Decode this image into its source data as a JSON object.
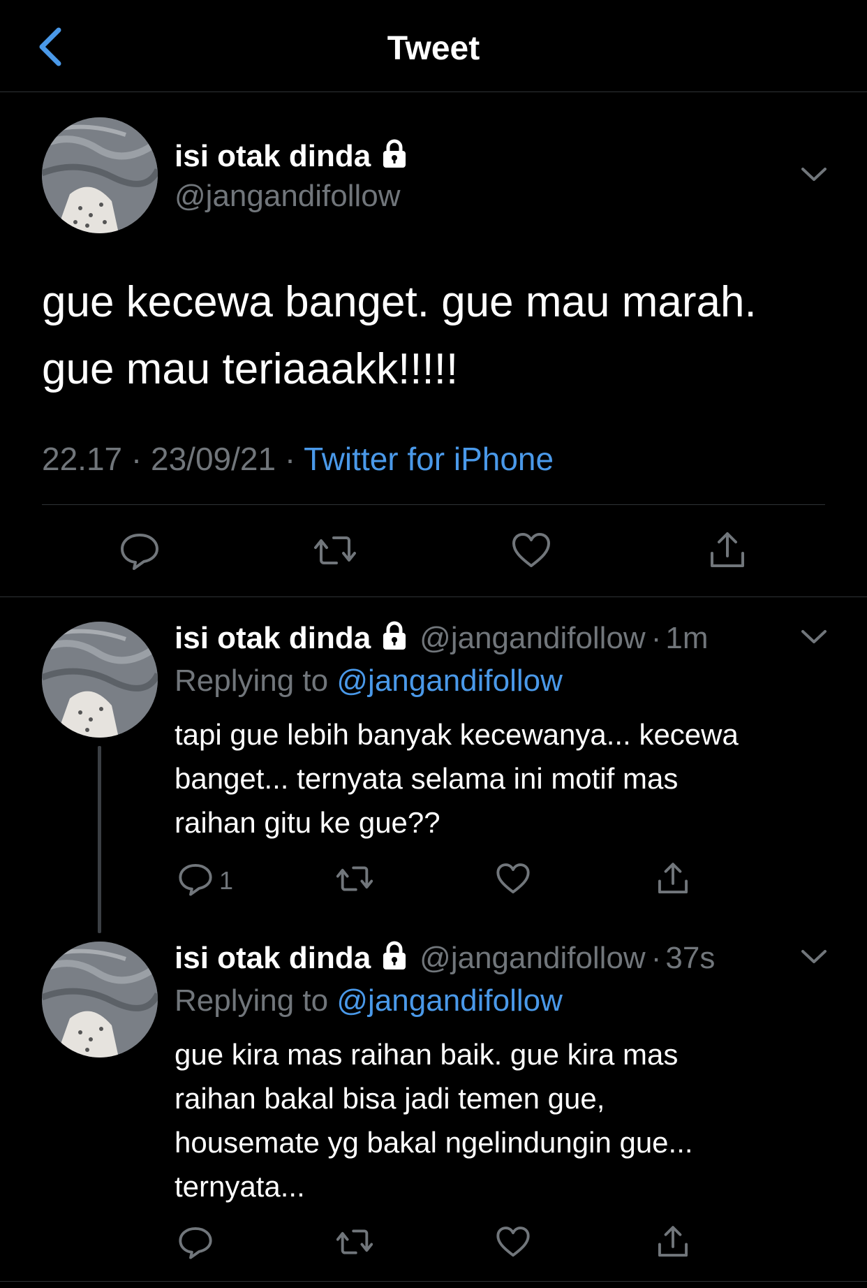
{
  "header": {
    "title": "Tweet",
    "back_icon": "chevron-left-icon"
  },
  "colors": {
    "accent": "#4a99e9",
    "muted": "#71767b",
    "background": "#000000"
  },
  "main_tweet": {
    "name": "isi otak dinda",
    "handle": "@jangandifollow",
    "text_line1": "gue kecewa banget. gue mau marah.",
    "text_line2": "gue mau teriaaakk!!!!!",
    "time": "22.17",
    "date": "23/09/21",
    "sep": "·",
    "source": "Twitter for iPhone"
  },
  "replies": [
    {
      "name": "isi otak dinda",
      "handle": "@jangandifollow",
      "sep": "·",
      "time": "1m",
      "replying_label": "Replying to",
      "mention": "@jangandifollow",
      "line1": "tapi gue lebih banyak kecewanya... kecewa",
      "line2": "banget... ternyata selama ini motif mas",
      "line3": "raihan gitu ke gue??",
      "reply_count": "1"
    },
    {
      "name": "isi otak dinda",
      "handle": "@jangandifollow",
      "sep": "·",
      "time": "37s",
      "replying_label": "Replying to",
      "mention": "@jangandifollow",
      "line1": "gue kira mas raihan baik. gue kira mas",
      "line2": "raihan bakal bisa jadi temen gue,",
      "line3": "housemate yg bakal ngelindungin gue...",
      "line4": "ternyata..."
    }
  ]
}
